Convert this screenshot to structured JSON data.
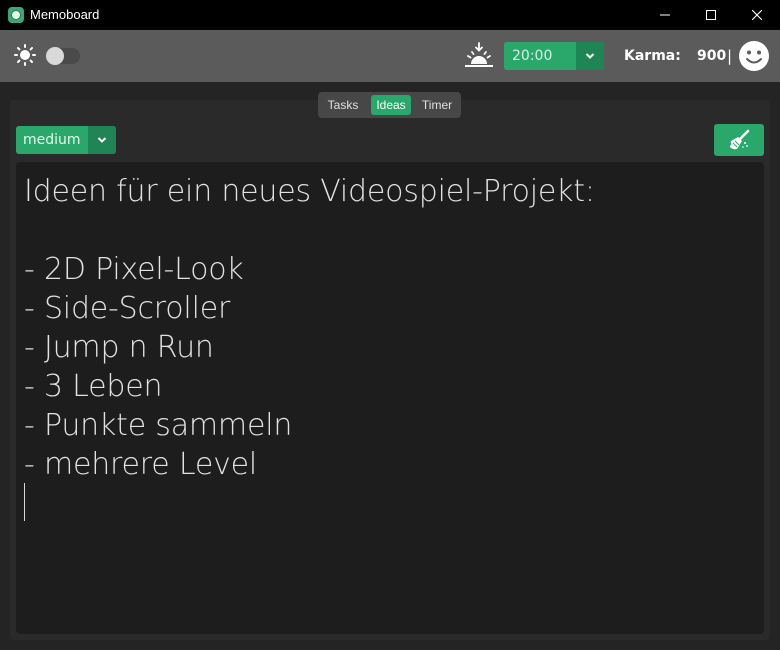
{
  "window": {
    "title": "Memoboard",
    "minimize_glyph": "—",
    "maximize_glyph": "☐",
    "close_glyph": "✕"
  },
  "toolbar": {
    "theme_icon": "sun-icon",
    "theme_toggle_on": false,
    "sunset_icon": "sunset-icon",
    "time_value": "20:00",
    "karma_label": "Karma:",
    "karma_value": "900",
    "karma_separator": "|",
    "mood_icon": "smiley-icon"
  },
  "tabs": [
    {
      "label": "Tasks",
      "active": false
    },
    {
      "label": "Ideas",
      "active": true
    },
    {
      "label": "Timer",
      "active": false
    }
  ],
  "priority": {
    "value": "medium"
  },
  "clear_button": {
    "icon": "broom-icon"
  },
  "editor": {
    "text": "Ideen für ein neues Videospiel-Projekt:\n\n- 2D Pixel-Look\n- Side-Scroller\n- Jump n Run\n- 3 Leben\n- Punkte sammeln\n- mehrere Level"
  },
  "colors": {
    "accent": "#2aa86b",
    "accent_dark": "#1f8554",
    "toolbar_bg": "#5b5b5b",
    "editor_bg": "#1d1d1d"
  }
}
